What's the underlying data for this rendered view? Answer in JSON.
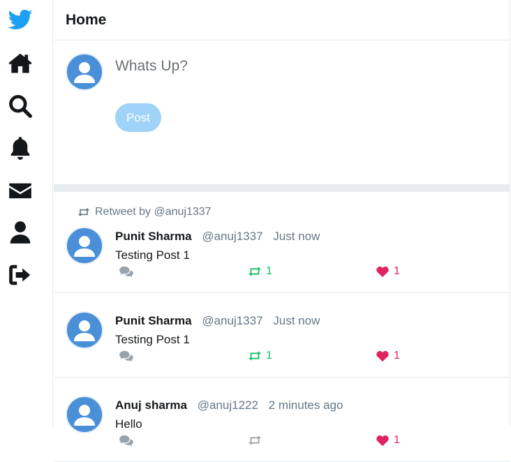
{
  "colors": {
    "brand": "#1da1f2",
    "retweet_active": "#17bf63",
    "like_active": "#e0245e",
    "muted": "#657786"
  },
  "nav": {
    "items": [
      {
        "icon": "twitter-bird-icon"
      },
      {
        "icon": "home-icon"
      },
      {
        "icon": "search-icon"
      },
      {
        "icon": "bell-icon"
      },
      {
        "icon": "envelope-icon"
      },
      {
        "icon": "user-icon"
      },
      {
        "icon": "logout-icon"
      }
    ]
  },
  "header": {
    "title": "Home"
  },
  "composer": {
    "placeholder": "Whats Up?",
    "post_label": "Post"
  },
  "posts": [
    {
      "retweet_by": "Retweet by @anuj1337",
      "name": "Punit Sharma",
      "handle": "@anuj1337",
      "time": "Just now",
      "text": "Testing Post 1",
      "retweets": "1",
      "likes": "1",
      "retweeted": true,
      "liked": true
    },
    {
      "name": "Punit Sharma",
      "handle": "@anuj1337",
      "time": "Just now",
      "text": "Testing Post 1",
      "retweets": "1",
      "likes": "1",
      "retweeted": true,
      "liked": true
    },
    {
      "name": "Anuj sharma",
      "handle": "@anuj1222",
      "time": "2 minutes ago",
      "text": "Hello",
      "retweets": "",
      "likes": "1",
      "retweeted": false,
      "liked": true
    }
  ]
}
